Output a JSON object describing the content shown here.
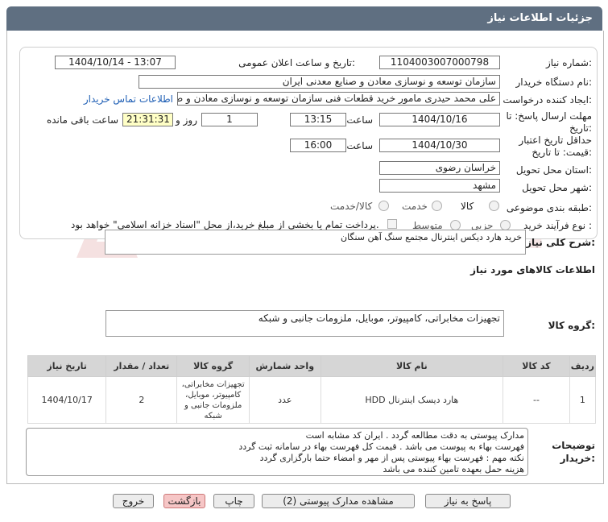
{
  "header": {
    "title": "جزئیات اطلاعات نیاز"
  },
  "form": {
    "need_number_label": "شماره نیاز:",
    "need_number": "1104003007000798",
    "announce_label": "تاریخ و ساعت اعلان عمومی:",
    "announce_value": "1404/10/14 - 13:07",
    "buyer_org_label": "نام دستگاه خریدار:",
    "buyer_org": "سازمان توسعه و نوسازی معادن و صنایع معدنی ایران",
    "requester_label": "ایجاد کننده درخواست:",
    "requester": "علی محمد حیدری مامور خرید قطعات فنی سازمان توسعه و نوسازی معادن و ص",
    "contact_link": "اطلاعات تماس خریدار",
    "deadline_label_1": "مهلت ارسال پاسخ: تا",
    "deadline_label_2": "تاریخ:",
    "deadline_date": "1404/10/16",
    "time_label": "ساعت",
    "deadline_time": "13:15",
    "days_value": "1",
    "days_label": "روز و",
    "remaining_time": "21:31:31",
    "remaining_label": "ساعت باقی مانده",
    "min_validity_label_1": "حداقل تاریخ اعتبار",
    "min_validity_label_2": "قیمت: تا تاریخ:",
    "validity_date": "1404/10/30",
    "validity_time": "16:00",
    "province_label": "استان محل تحویل:",
    "province": "خراسان رضوی",
    "city_label": "شهر محل تحویل:",
    "city": "مشهد",
    "category_label": "طبقه بندی موضوعی:",
    "category_options": [
      "کالا",
      "خدمت",
      "کالا/خدمت"
    ],
    "purchase_type_label": "نوع فرآیند خرید :",
    "purchase_options": [
      "جزیی",
      "متوسط"
    ],
    "treasury_note": "پرداخت تمام یا بخشی از مبلغ خرید،از محل \"اسناد خزانه اسلامی\" خواهد بود."
  },
  "description": {
    "label": "شرح کلی نیاز:",
    "text": "خرید هارد دیکس اینترنال مجتمع سنگ آهن سنگان"
  },
  "goods_info": {
    "title": "اطلاعات کالاهای مورد نیاز",
    "group_label": "گروه کالا:",
    "group_value": "تجهیزات مخابراتی، کامپیوتر، موبایل، ملزومات جانبی و شبکه"
  },
  "table": {
    "headers": [
      "ردیف",
      "کد کالا",
      "نام کالا",
      "واحد شمارش",
      "گروه کالا",
      "تعداد / مقدار",
      "تاریخ نیاز"
    ],
    "rows": [
      {
        "row": "1",
        "code": "--",
        "name": "هارد دیسک اینترنال HDD",
        "unit": "عدد",
        "group": "تجهیزات مخابراتی، کامپیوتر، موبایل، ملزومات جانبی و شبکه",
        "quantity": "2",
        "date": "1404/10/17"
      }
    ]
  },
  "buyer_notes": {
    "label_1": "توضیحات",
    "label_2": "خریدار:",
    "lines": [
      "مدارک پیوستی به دقت مطالعه گردد . ایران کد مشابه است",
      "فهرست بهاء به پیوست می باشد . قیمت کل فهرست بهاء در سامانه ثبت گردد",
      "نکته مهم : فهرست بهاء پیوستی پس از مهر و امضاء حتما بارگزاری گردد",
      "هزینه حمل بعهده تامین کننده می باشد"
    ]
  },
  "buttons": {
    "reply": "پاسخ به نیاز",
    "attachments": "مشاهده مدارک پیوستی (2)",
    "print": "چاپ",
    "back": "بازگشت",
    "exit": "خروج"
  },
  "watermark": {
    "text": "AriaTender.net"
  },
  "colors": {
    "header_bg": "#5f6f81",
    "remaining_bg": "#ffffc6",
    "link": "#1f5fb5",
    "back_button": "#f6c6c6"
  }
}
